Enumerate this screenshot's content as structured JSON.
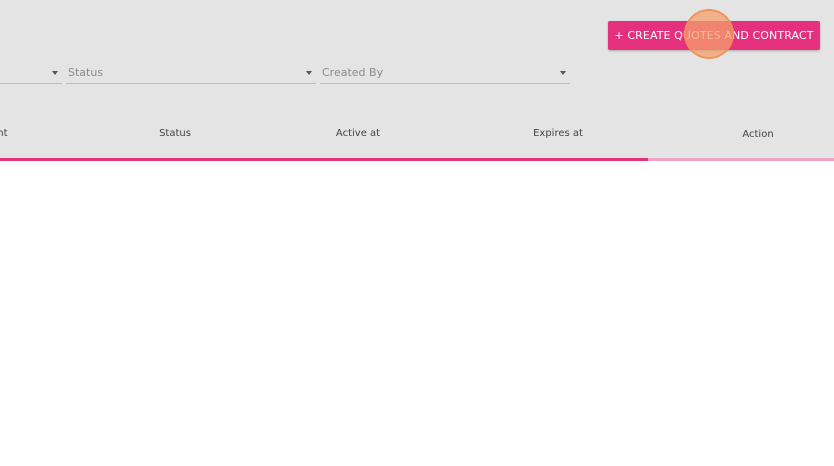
{
  "header": {
    "create_button_label": "+ CREATE QUOTES AND CONTRACT"
  },
  "filters": [
    {
      "label": ""
    },
    {
      "label": "Status"
    },
    {
      "label": "Created By"
    }
  ],
  "table": {
    "columns": [
      "ent",
      "Status",
      "Active at",
      "Expires at",
      "Action"
    ]
  },
  "loading_progress": 0.777,
  "colors": {
    "accent": "#e4307d",
    "accent_light": "#f0a5c4",
    "header_bg": "#e4e4e4",
    "click_indicator": "#f4a06e"
  },
  "icons": {
    "dropdown": "caret-down-icon"
  }
}
